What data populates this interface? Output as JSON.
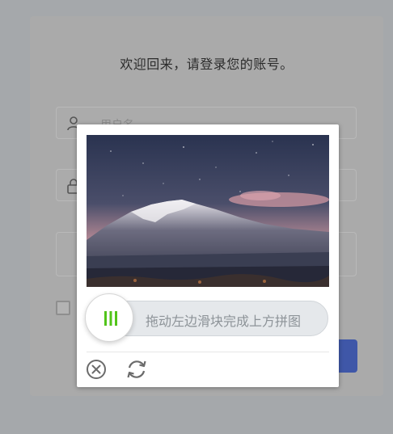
{
  "login": {
    "welcome_text": "欢迎回来，请登录您的账号。",
    "username_placeholder": "用户名"
  },
  "captcha": {
    "slider_hint": "拖动左边滑块完成上方拼图",
    "image_subject": "snow-capped mountain under starry night sky",
    "accent_color": "#52c41a"
  },
  "icons": {
    "user": "user-icon",
    "lock": "lock-icon",
    "close": "close-icon",
    "refresh": "refresh-icon",
    "handle": "slider-grip-icon"
  }
}
